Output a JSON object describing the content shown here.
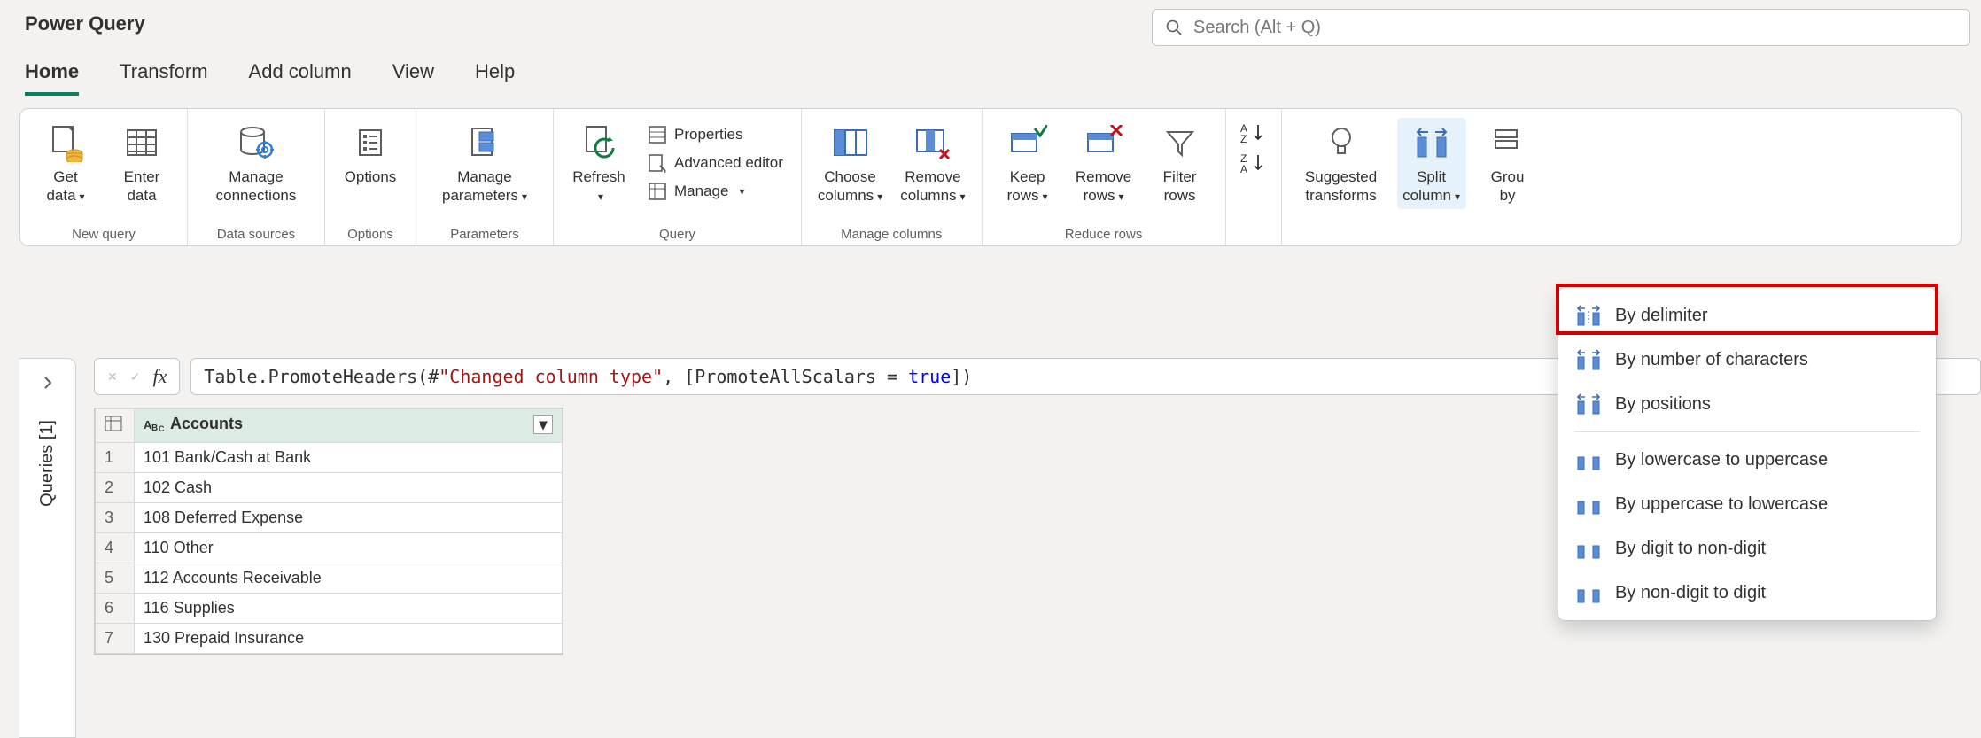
{
  "app_title": "Power Query",
  "search_placeholder": "Search (Alt + Q)",
  "tabs": [
    "Home",
    "Transform",
    "Add column",
    "View",
    "Help"
  ],
  "ribbon": {
    "new_query": {
      "label": "New query",
      "get_data": "Get\ndata",
      "enter_data": "Enter\ndata"
    },
    "data_sources": {
      "label": "Data sources",
      "manage_connections": "Manage\nconnections"
    },
    "options_group": {
      "label": "Options",
      "options": "Options"
    },
    "parameters": {
      "label": "Parameters",
      "manage_parameters": "Manage\nparameters"
    },
    "query": {
      "label": "Query",
      "refresh": "Refresh",
      "properties": "Properties",
      "advanced_editor": "Advanced editor",
      "manage": "Manage"
    },
    "manage_columns": {
      "label": "Manage columns",
      "choose": "Choose\ncolumns",
      "remove": "Remove\ncolumns"
    },
    "reduce_rows": {
      "label": "Reduce rows",
      "keep": "Keep\nrows",
      "remove": "Remove\nrows",
      "filter": "Filter\nrows"
    },
    "suggested": "Suggested\ntransforms",
    "split_column": "Split\ncolumn",
    "group_by": "Grou\nby"
  },
  "queries_pane": "Queries [1]",
  "formula": {
    "prefix": "Table.PromoteHeaders(#",
    "str": "\"Changed column type\"",
    "mid": ", [PromoteAllScalars = ",
    "kw": "true",
    "suffix": "])"
  },
  "table": {
    "header": "Accounts",
    "rows": [
      "101 Bank/Cash at Bank",
      "102 Cash",
      "108 Deferred Expense",
      "110 Other",
      "112 Accounts Receivable",
      "116 Supplies",
      "130 Prepaid Insurance"
    ]
  },
  "dropdown": {
    "by_delimiter": "By delimiter",
    "by_num_chars": "By number of characters",
    "by_positions": "By positions",
    "lower_upper": "By lowercase to uppercase",
    "upper_lower": "By uppercase to lowercase",
    "digit_non": "By digit to non-digit",
    "non_digit": "By non-digit to digit"
  }
}
